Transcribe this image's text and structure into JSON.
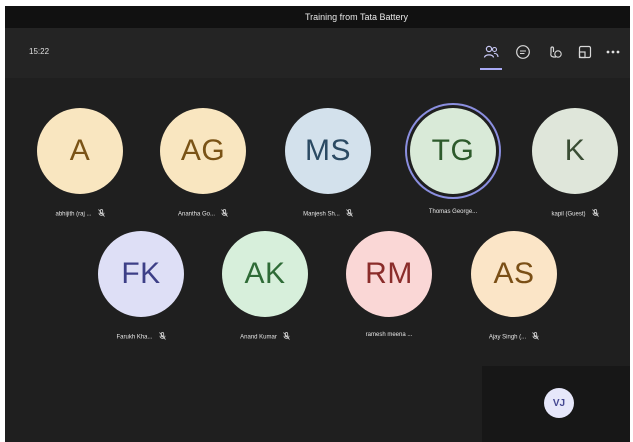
{
  "window": {
    "title": "Training from Tata Battery"
  },
  "toolbar": {
    "clock": "15:22",
    "icons": [
      "people-icon",
      "chat-icon",
      "react-icon",
      "share-icon",
      "more-icon"
    ],
    "accent": "#a9aaf5"
  },
  "participants": [
    {
      "initials": "A",
      "name": "abhijith (raj ...",
      "muted": true,
      "bg": "#f9e6c0",
      "fg": "#7a5316"
    },
    {
      "initials": "AG",
      "name": "Anantha Go...",
      "muted": true,
      "bg": "#f9e6c0",
      "fg": "#7a5316"
    },
    {
      "initials": "MS",
      "name": "Manjesh Sh...",
      "muted": true,
      "bg": "#d3e1ec",
      "fg": "#2b4a63"
    },
    {
      "initials": "TG",
      "name": "Thomas George...",
      "muted": false,
      "bg": "#d9ead8",
      "fg": "#2d5a2b",
      "speaking": true
    },
    {
      "initials": "K",
      "name": "kapil (Guest)",
      "muted": true,
      "bg": "#dfe6da",
      "fg": "#3a4d34"
    },
    {
      "initials": "FK",
      "name": "Farukh Kha...",
      "muted": true,
      "bg": "#dedff6",
      "fg": "#3d3f87"
    },
    {
      "initials": "AK",
      "name": "Anand Kumar",
      "muted": true,
      "bg": "#d7efdb",
      "fg": "#2f6b37"
    },
    {
      "initials": "RM",
      "name": "ramesh meena ...",
      "muted": false,
      "bg": "#fad7d6",
      "fg": "#8a2c2a"
    },
    {
      "initials": "AS",
      "name": "Ajay Singh (...",
      "muted": true,
      "bg": "#fbe5c7",
      "fg": "#7a4f16"
    }
  ],
  "self": {
    "initials": "VJ"
  }
}
